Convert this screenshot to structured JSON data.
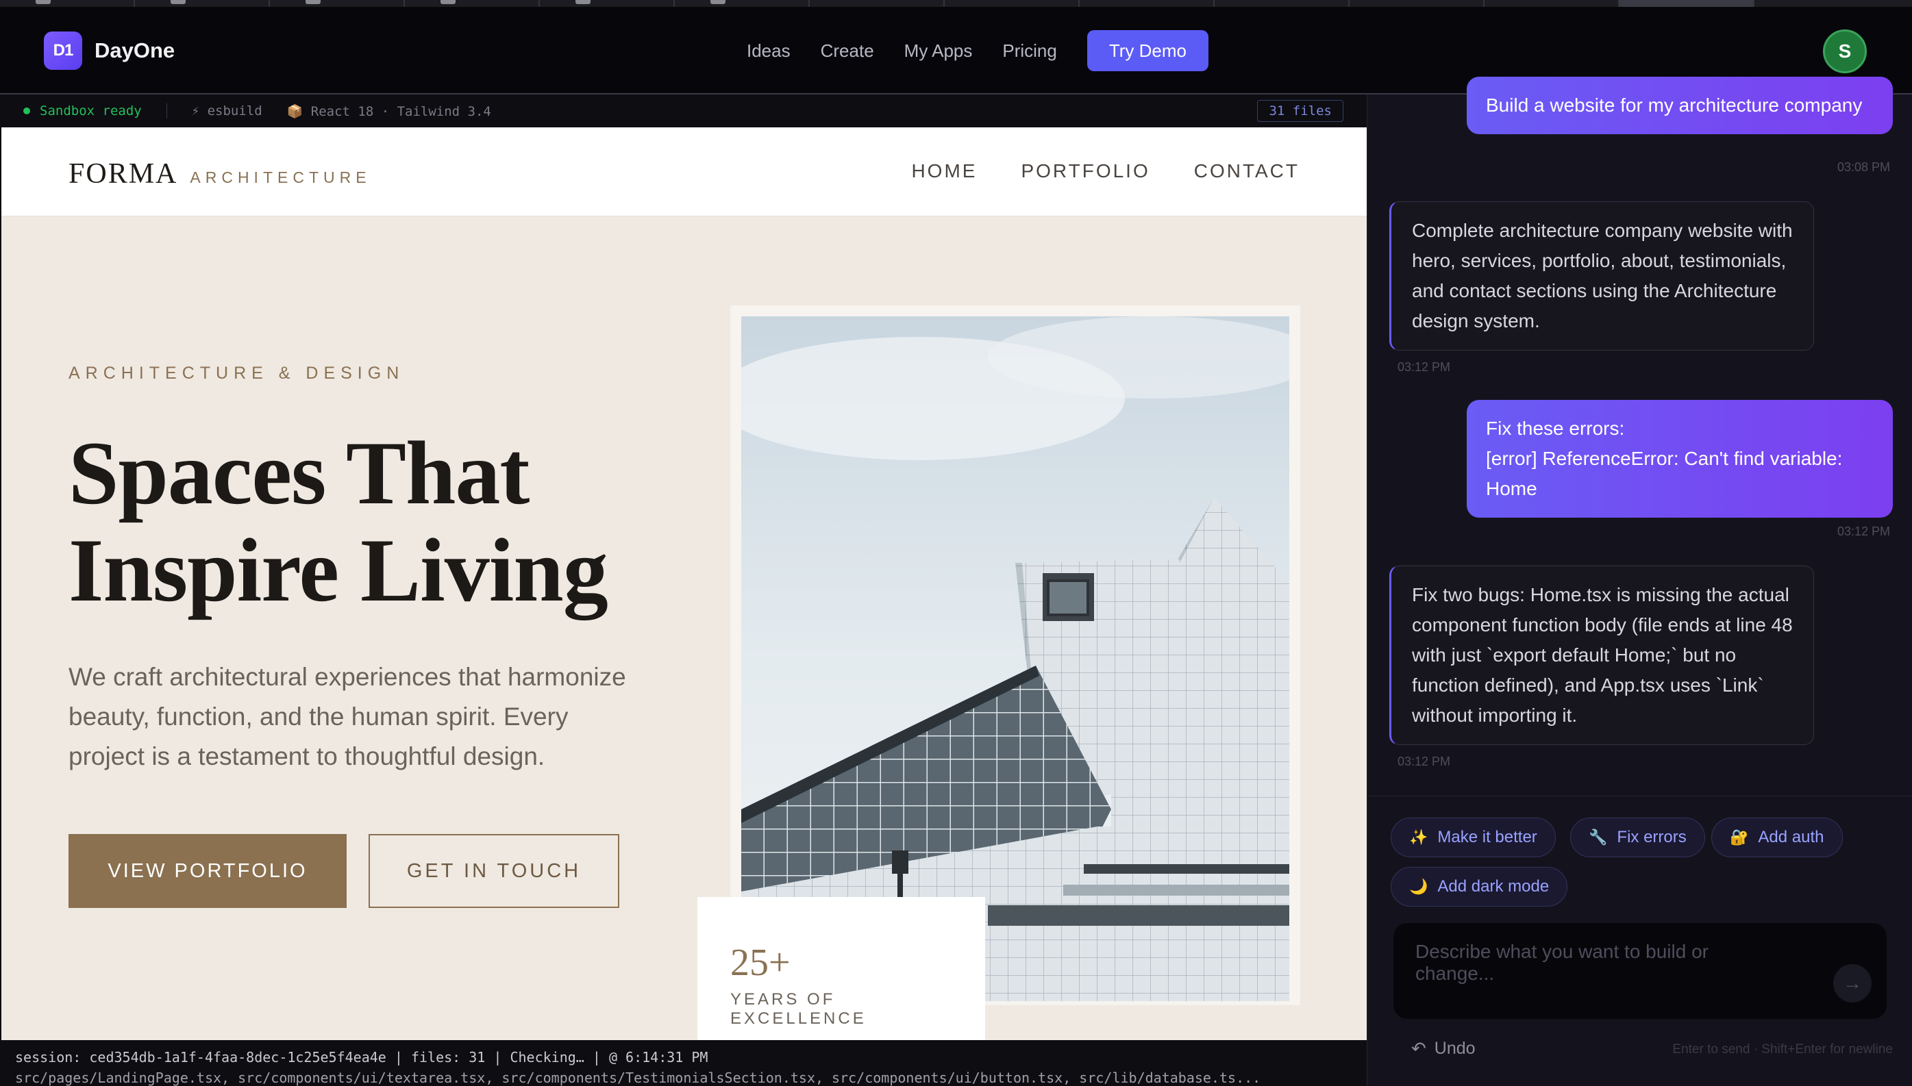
{
  "app": {
    "logo_text": "DayOne",
    "logo_mark": "D1",
    "nav": [
      "Ideas",
      "Create",
      "My Apps",
      "Pricing"
    ],
    "cta": "Try Demo",
    "avatar_initial": "S"
  },
  "sandbox": {
    "status": "Sandbox ready",
    "bundler": "⚡ esbuild",
    "stack": "📦 React 18 · Tailwind 3.4",
    "files": "31 files"
  },
  "site": {
    "brand": "FORMA",
    "brand_sub": "ARCHITECTURE",
    "nav": [
      "HOME",
      "PORTFOLIO",
      "CONTACT"
    ],
    "eyebrow": "ARCHITECTURE & DESIGN",
    "title_line1": "Spaces That",
    "title_line2": "Inspire Living",
    "body": "We craft architectural experiences that harmonize beauty, function, and the human spirit. Every project is a testament to thoughtful design.",
    "primary_button": "VIEW PORTFOLIO",
    "secondary_button": "GET IN TOUCH",
    "stat_value": "25+",
    "stat_label": "YEARS OF EXCELLENCE"
  },
  "status": {
    "line1": "session: ced354db-1a1f-4faa-8dec-1c25e5f4ea4e | files: 31 | Checking… | @ 6:14:31 PM",
    "line2": "src/pages/LandingPage.tsx, src/components/ui/textarea.tsx, src/components/TestimonialsSection.tsx, src/components/ui/button.tsx, src/lib/database.ts..."
  },
  "chat": {
    "messages": [
      {
        "role": "user",
        "text": "Build a website for my architecture company",
        "time": "03:08 PM"
      },
      {
        "role": "assistant",
        "text": "Complete architecture company website with hero, services, portfolio, about, testimonials, and contact sections using the Architecture design system.",
        "time": "03:12 PM"
      },
      {
        "role": "user",
        "text_lines": [
          "Fix these errors:",
          "[error] ReferenceError: Can't find variable: Home"
        ],
        "time": "03:12 PM"
      },
      {
        "role": "assistant",
        "text": "Fix two bugs: Home.tsx is missing the actual component function body (file ends at line 48 with just `export default Home;` but no function defined), and App.tsx uses `Link` without importing it.",
        "time": "03:12 PM"
      }
    ],
    "chips": [
      {
        "icon": "✨",
        "label": "Make it better"
      },
      {
        "icon": "🔧",
        "label": "Fix errors"
      },
      {
        "icon": "🔐",
        "label": "Add auth"
      },
      {
        "icon": "🌙",
        "label": "Add dark mode"
      }
    ],
    "placeholder": "Describe what you want to build or change...",
    "undo": "Undo",
    "hint": "Enter to send · Shift+Enter for newline"
  },
  "colors": {
    "accent": "#5b5bf6",
    "brand_bronze": "#8b7150",
    "success": "#23c05a"
  }
}
